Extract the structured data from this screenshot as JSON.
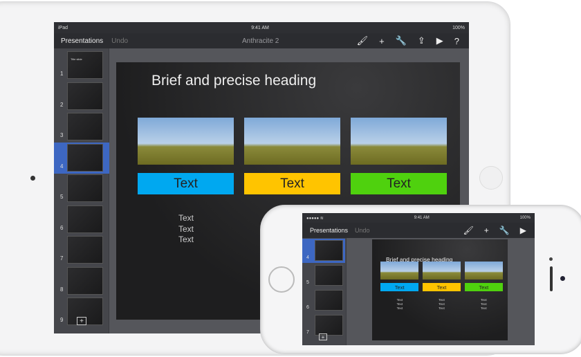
{
  "ipad": {
    "status": {
      "carrier": "iPad",
      "time": "9:41 AM",
      "battery": "100%"
    },
    "toolbar": {
      "presentations": "Presentations",
      "undo": "Undo",
      "title": "Anthracite 2",
      "icons": [
        "paintbrush-icon",
        "plus-icon",
        "wrench-icon",
        "share-icon",
        "play-icon",
        "help-icon"
      ]
    },
    "slides": [
      {
        "n": "1",
        "label": "Title slide"
      },
      {
        "n": "2"
      },
      {
        "n": "3"
      },
      {
        "n": "4"
      },
      {
        "n": "5"
      },
      {
        "n": "6"
      },
      {
        "n": "7"
      },
      {
        "n": "8"
      },
      {
        "n": "9"
      }
    ],
    "selected_slide": "4"
  },
  "iphone": {
    "status": {
      "time": "9:41 AM",
      "battery": "100%"
    },
    "toolbar": {
      "presentations": "Presentations",
      "undo": "Undo"
    },
    "slides": [
      "4",
      "5",
      "6",
      "7"
    ]
  },
  "slide": {
    "heading": "Brief and precise heading",
    "columns": [
      {
        "label": "Text",
        "color": "#00a8f0",
        "lines": [
          "Text",
          "Text",
          "Text"
        ]
      },
      {
        "label": "Text",
        "color": "#ffc400",
        "lines": [
          "Text",
          "Text",
          "Text"
        ]
      },
      {
        "label": "Text",
        "color": "#4fd10e",
        "lines": [
          "Text",
          "Text",
          "Text"
        ]
      }
    ]
  }
}
